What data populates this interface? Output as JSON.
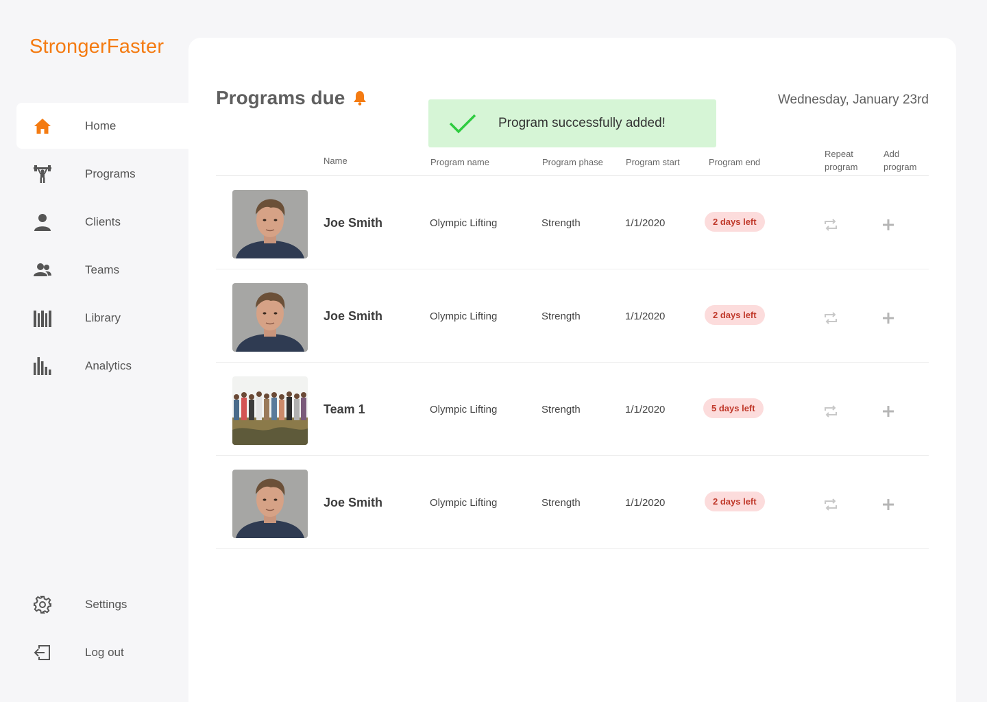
{
  "app": {
    "brand": "StrongerFaster"
  },
  "sidebar": {
    "items": [
      {
        "label": "Home",
        "icon": "home-icon",
        "active": true
      },
      {
        "label": "Programs",
        "icon": "weightlifter-icon"
      },
      {
        "label": "Clients",
        "icon": "person-icon"
      },
      {
        "label": "Teams",
        "icon": "group-icon"
      },
      {
        "label": "Library",
        "icon": "library-icon"
      },
      {
        "label": "Analytics",
        "icon": "analytics-icon"
      }
    ],
    "bottom": [
      {
        "label": "Settings",
        "icon": "gear-icon"
      },
      {
        "label": "Log out",
        "icon": "logout-icon"
      }
    ]
  },
  "main": {
    "title": "Programs due",
    "date": "Wednesday, January 23rd",
    "toast": "Program successfully added!",
    "columns": {
      "name": "Name",
      "program_name": "Program name",
      "program_phase": "Program phase",
      "program_start": "Program start",
      "program_end": "Program end",
      "repeat": "Repeat program",
      "add": "Add program"
    },
    "rows": [
      {
        "name": "Joe Smith",
        "program": "Olympic Lifting",
        "phase": "Strength",
        "start": "1/1/2020",
        "end": "2 days left"
      },
      {
        "name": "Joe Smith",
        "program": "Olympic Lifting",
        "phase": "Strength",
        "start": "1/1/2020",
        "end": "2 days left"
      },
      {
        "name": "Team 1",
        "program": "Olympic Lifting",
        "phase": "Strength",
        "start": "1/1/2020",
        "end": "5 days left"
      },
      {
        "name": "Joe Smith",
        "program": "Olympic Lifting",
        "phase": "Strength",
        "start": "1/1/2020",
        "end": "2 days left"
      }
    ]
  },
  "colors": {
    "accent": "#f47b12",
    "success_bg": "#d6f5d6",
    "success_check": "#2ecc40",
    "badge_bg": "#fcdcdc",
    "badge_text": "#c0392b"
  }
}
